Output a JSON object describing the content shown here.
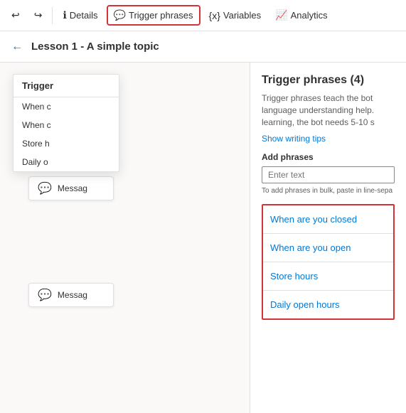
{
  "toolbar": {
    "undo_label": "↩",
    "redo_label": "↪",
    "details_label": "Details",
    "trigger_phrases_label": "Trigger phrases",
    "variables_label": "Variables",
    "analytics_label": "Analytics",
    "details_icon": "ℹ",
    "trigger_icon": "💬",
    "variables_icon": "{x}",
    "analytics_icon": "📈"
  },
  "breadcrumb": {
    "back_icon": "←",
    "title": "Lesson 1 - A simple topic"
  },
  "dropdown": {
    "header": "Trigger",
    "items": [
      "When c",
      "When c",
      "Store h",
      "Daily o"
    ]
  },
  "nodes": {
    "message_label": "Messag"
  },
  "right_panel": {
    "title": "Trigger phrases (4)",
    "description": "Trigger phrases teach the bot language understanding help. learning, the bot needs 5-10 s",
    "show_tips_label": "Show writing tips",
    "add_phrases_label": "Add phrases",
    "input_placeholder": "Enter text",
    "bulk_hint": "To add phrases in bulk, paste in line-sepa",
    "phrases": [
      "When are you closed",
      "When are you open",
      "Store hours",
      "Daily open hours"
    ]
  }
}
